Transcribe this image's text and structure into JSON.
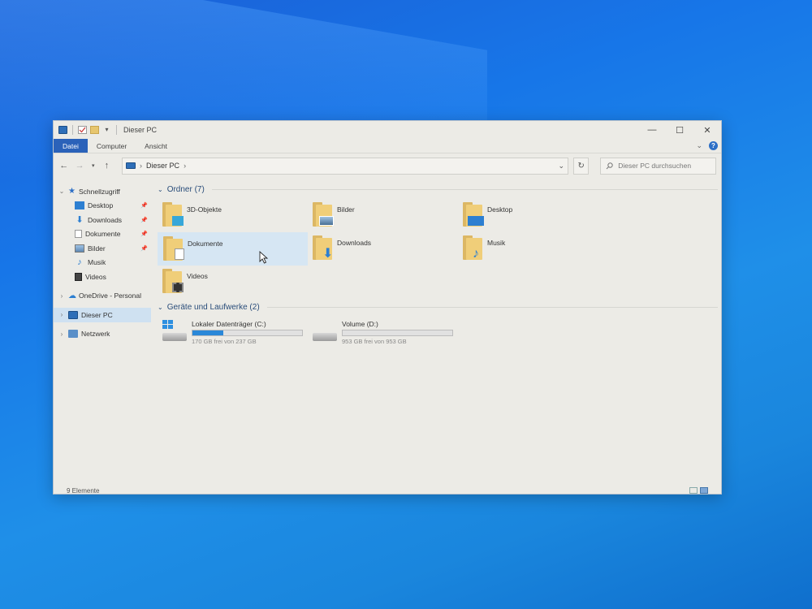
{
  "window": {
    "title": "Dieser PC",
    "controls": {
      "minimize": "—",
      "maximize": "☐",
      "close": "✕"
    }
  },
  "ribbon": {
    "tabs": [
      "Datei",
      "Computer",
      "Ansicht"
    ],
    "help": "?"
  },
  "navigation": {
    "address": {
      "root_chevron": "›",
      "crumb": "Dieser PC",
      "trail_chevron": "›"
    },
    "search_placeholder": "Dieser PC durchsuchen"
  },
  "sidebar": {
    "quick_access": "Schnellzugriff",
    "pinned": [
      "Desktop",
      "Downloads",
      "Dokumente",
      "Bilder"
    ],
    "recent": [
      "Musik",
      "Videos"
    ],
    "onedrive": "OneDrive - Personal",
    "this_pc": "Dieser PC",
    "network": "Netzwerk"
  },
  "content": {
    "folders_header": "Ordner (7)",
    "folders": [
      {
        "name": "3D-Objekte",
        "badge": "cube-icon"
      },
      {
        "name": "Bilder",
        "badge": "picture-icon"
      },
      {
        "name": "Desktop",
        "badge": "desktop-icon"
      },
      {
        "name": "Dokumente",
        "badge": "document-icon"
      },
      {
        "name": "Downloads",
        "badge": "download-arrow-icon"
      },
      {
        "name": "Musik",
        "badge": "music-note-icon"
      },
      {
        "name": "Videos",
        "badge": "film-icon"
      }
    ],
    "drives_header": "Geräte und Laufwerke (2)",
    "drives": [
      {
        "name": "Lokaler Datenträger (C:)",
        "free": "170 GB frei von 237 GB",
        "used_fraction": 0.28
      },
      {
        "name": "Volume (D:)",
        "free": "953 GB frei von 953 GB",
        "used_fraction": 0.0
      }
    ]
  },
  "status": {
    "items": "9 Elemente"
  },
  "colors": {
    "accent": "#2b62b9",
    "folder": "#f0ce79",
    "selection": "#cfe1f1"
  }
}
